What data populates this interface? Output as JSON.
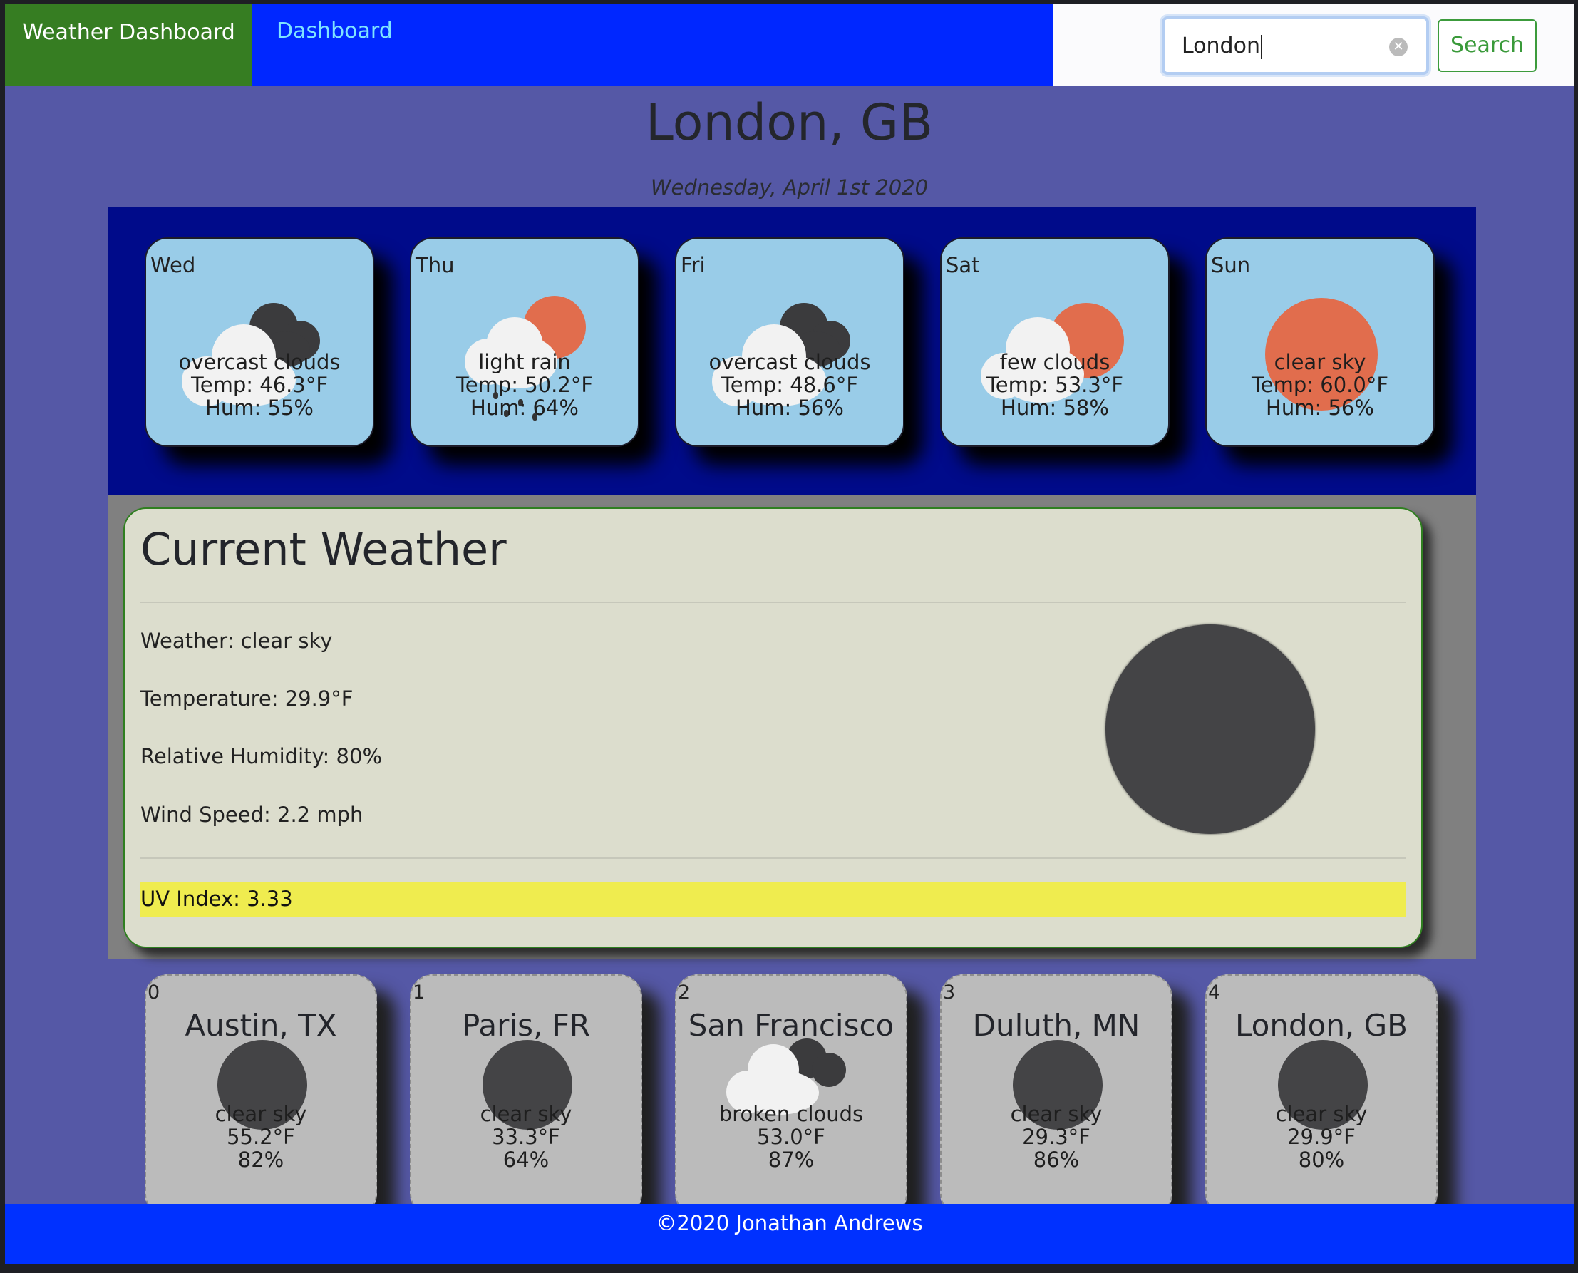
{
  "nav": {
    "brand": "Weather Dashboard",
    "link": "Dashboard",
    "search_value": "London",
    "search_button": "Search"
  },
  "header": {
    "city": "London, GB",
    "date": "Wednesday, April 1st 2020"
  },
  "forecast": [
    {
      "day": "Wed",
      "desc": "overcast clouds",
      "temp": "Temp: 46.3°F",
      "hum": "Hum: 55%",
      "icon": "overcast-clouds-icon"
    },
    {
      "day": "Thu",
      "desc": "light rain",
      "temp": "Temp: 50.2°F",
      "hum": "Hum: 64%",
      "icon": "light-rain-icon"
    },
    {
      "day": "Fri",
      "desc": "overcast clouds",
      "temp": "Temp: 48.6°F",
      "hum": "Hum: 56%",
      "icon": "overcast-clouds-icon"
    },
    {
      "day": "Sat",
      "desc": "few clouds",
      "temp": "Temp: 53.3°F",
      "hum": "Hum: 58%",
      "icon": "few-clouds-icon"
    },
    {
      "day": "Sun",
      "desc": "clear sky",
      "temp": "Temp: 60.0°F",
      "hum": "Hum: 56%",
      "icon": "clear-sky-icon"
    }
  ],
  "current": {
    "title": "Current Weather",
    "weather": "Weather: clear sky",
    "temperature": "Temperature: 29.9°F",
    "humidity": "Relative Humidity: 80%",
    "wind": "Wind Speed: 2.2 mph",
    "uv": "UV Index: 3.33",
    "icon": "clear-sky-night-icon"
  },
  "history": [
    {
      "index": "0",
      "city": "Austin, TX",
      "desc": "clear sky",
      "temp": "55.2°F",
      "hum": "82%",
      "icon": "clear-sky-night-icon"
    },
    {
      "index": "1",
      "city": "Paris, FR",
      "desc": "clear sky",
      "temp": "33.3°F",
      "hum": "64%",
      "icon": "clear-sky-night-icon"
    },
    {
      "index": "2",
      "city": "San Francisco",
      "desc": "broken clouds",
      "temp": "53.0°F",
      "hum": "87%",
      "icon": "broken-clouds-icon"
    },
    {
      "index": "3",
      "city": "Duluth, MN",
      "desc": "clear sky",
      "temp": "29.3°F",
      "hum": "86%",
      "icon": "clear-sky-night-icon"
    },
    {
      "index": "4",
      "city": "London, GB",
      "desc": "clear sky",
      "temp": "29.9°F",
      "hum": "80%",
      "icon": "clear-sky-night-icon"
    }
  ],
  "footer": {
    "text": "©2020 Jonathan Andrews"
  },
  "colors": {
    "nav": "#0027ff",
    "brand": "#367d22",
    "background": "#5558a6",
    "forecast_band": "#000b8a",
    "uv": "#efec4f",
    "sun": "#e16d4d"
  }
}
